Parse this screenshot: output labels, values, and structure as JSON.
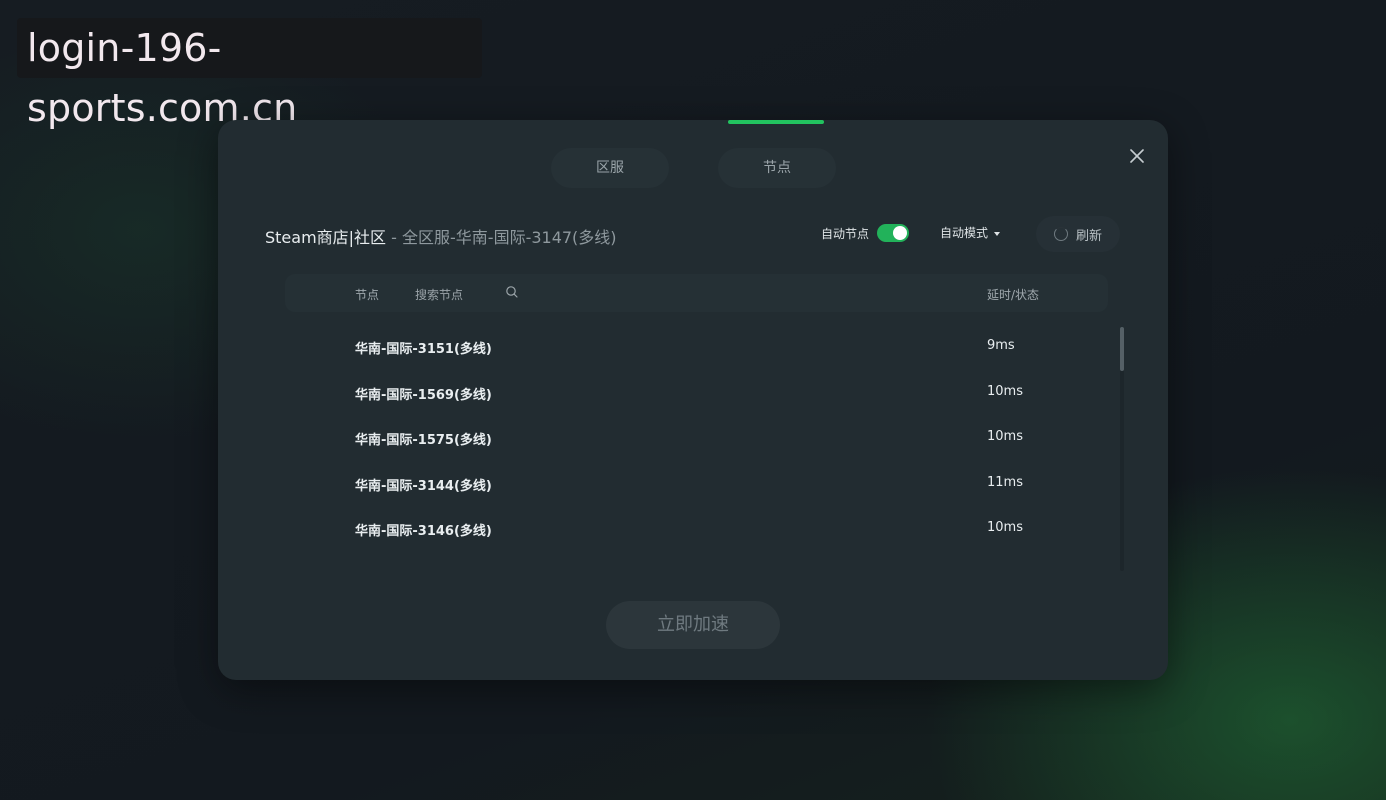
{
  "watermark": "login-196-sports.com.cn",
  "tabs": [
    {
      "label": "区服"
    },
    {
      "label": "节点"
    }
  ],
  "header": {
    "game": "Steam商店|社区",
    "separator": " - ",
    "server": "全区服-华南-国际-3147(多线)"
  },
  "controls": {
    "auto_node_label": "自动节点",
    "auto_node_on": true,
    "mode_label": "自动模式",
    "refresh_label": "刷新"
  },
  "table": {
    "col_node": "节点",
    "search_placeholder": "搜索节点",
    "col_latency": "延时/状态",
    "rows": [
      {
        "name": "华南-国际-3151(多线)",
        "latency": "9ms"
      },
      {
        "name": "华南-国际-1569(多线)",
        "latency": "10ms"
      },
      {
        "name": "华南-国际-1575(多线)",
        "latency": "10ms"
      },
      {
        "name": "华南-国际-3144(多线)",
        "latency": "11ms"
      },
      {
        "name": "华南-国际-3146(多线)",
        "latency": "10ms"
      }
    ]
  },
  "accelerate_label": "立即加速",
  "colors": {
    "accent": "#22c35f",
    "panel": "#222c31"
  }
}
